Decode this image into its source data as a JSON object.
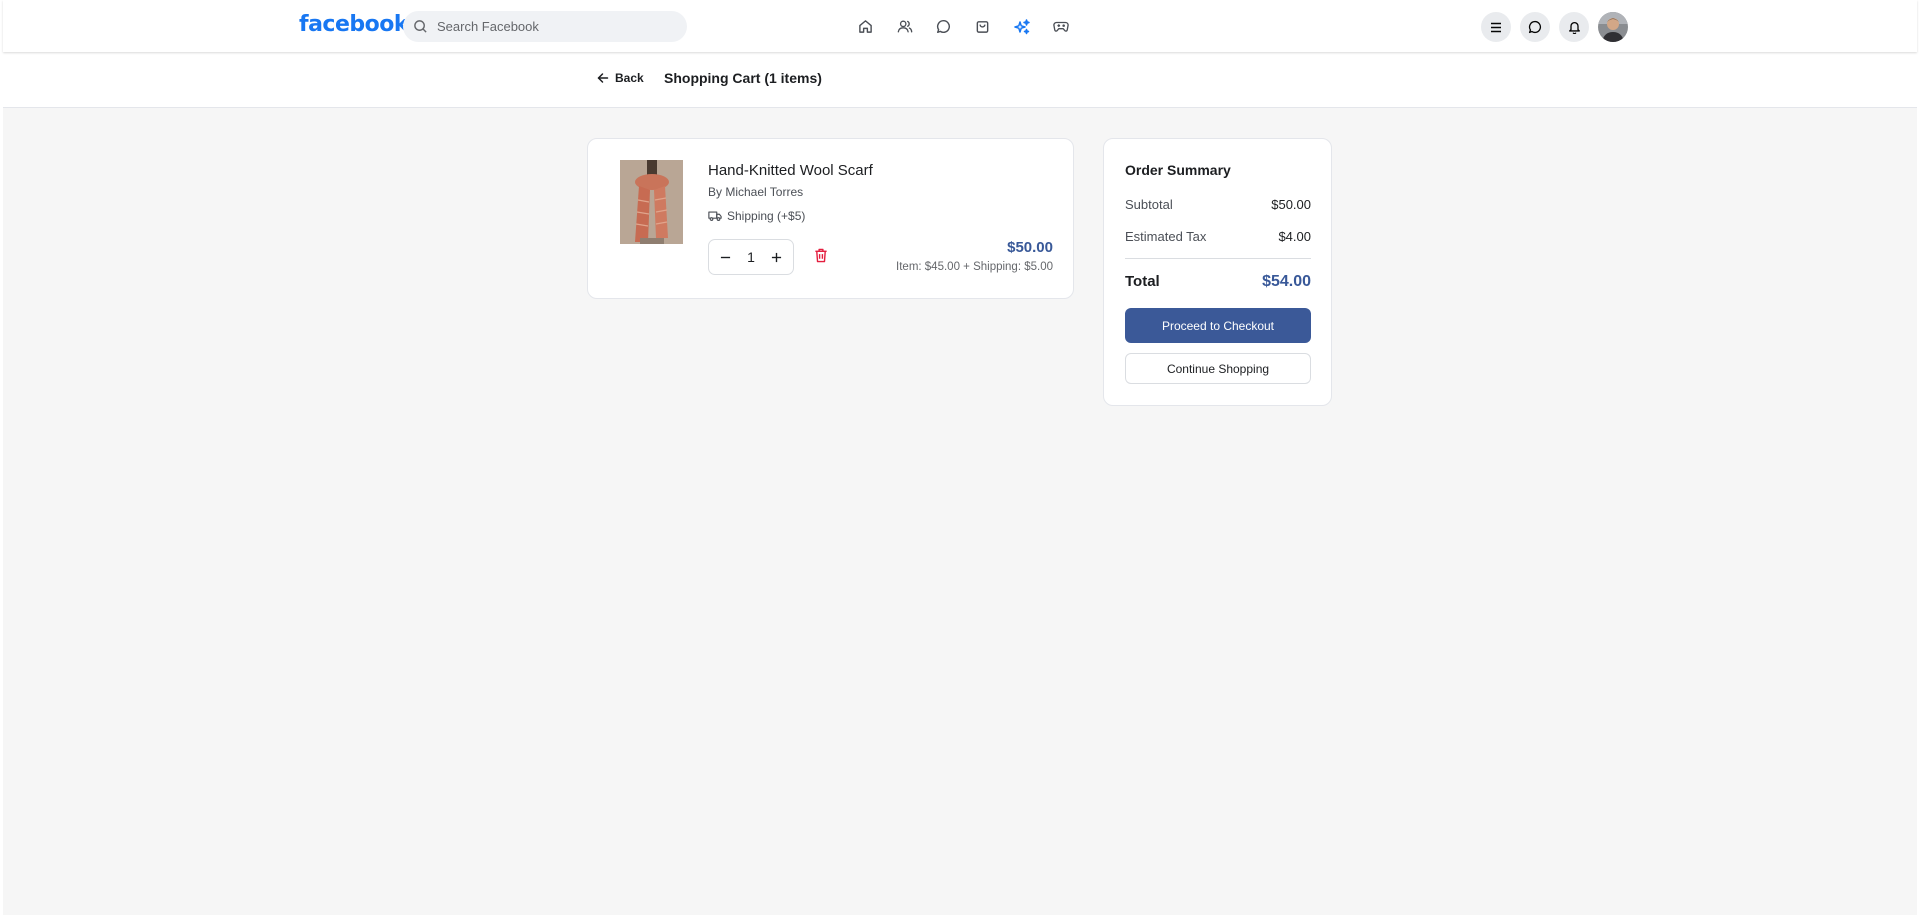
{
  "header": {
    "logo": "facebook",
    "search_placeholder": "Search Facebook",
    "nav_icons": [
      "home-icon",
      "friends-icon",
      "messenger-icon",
      "marketplace-bag-icon",
      "sparkle-icon",
      "gaming-icon"
    ],
    "active_nav": "sparkle-icon",
    "right_icons": [
      "menu-icon",
      "messenger-icon",
      "bell-icon",
      "avatar"
    ],
    "accent_color": "#1877f2"
  },
  "subheader": {
    "back_label": "Back",
    "title": "Shopping Cart (1 items)"
  },
  "cart": {
    "items": [
      {
        "name": "Hand-Knitted Wool Scarf",
        "seller": "By Michael Torres",
        "shipping": "Shipping (+$5)",
        "quantity": "1",
        "price": "$50.00",
        "breakdown": "Item: $45.00 + Shipping: $5.00"
      }
    ]
  },
  "summary": {
    "title": "Order Summary",
    "subtotal_label": "Subtotal",
    "subtotal_value": "$50.00",
    "tax_label": "Estimated Tax",
    "tax_value": "$4.00",
    "total_label": "Total",
    "total_value": "$54.00",
    "checkout_label": "Proceed to Checkout",
    "continue_label": "Continue Shopping",
    "button_color": "#3b5998",
    "total_color": "#385898"
  }
}
